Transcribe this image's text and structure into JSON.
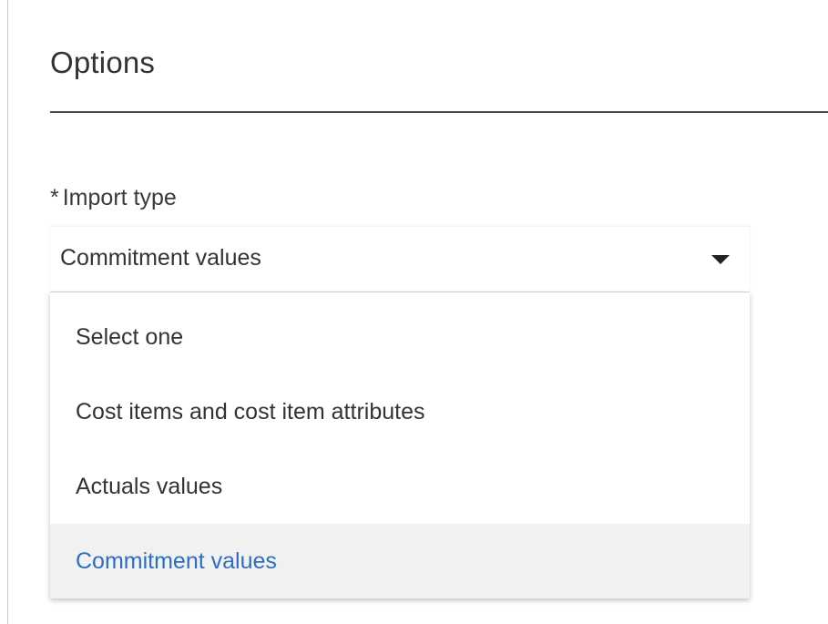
{
  "options": {
    "title": "Options"
  },
  "import_type": {
    "required_marker": "*",
    "label": "Import type",
    "selected_value": "Commitment values",
    "options": [
      {
        "label": "Select one",
        "selected": false
      },
      {
        "label": "Cost items and cost item attributes",
        "selected": false
      },
      {
        "label": "Actuals values",
        "selected": false
      },
      {
        "label": "Commitment values",
        "selected": true
      }
    ]
  },
  "colors": {
    "selected_text": "#2c6fc2",
    "selected_background": "#f1f1f2",
    "divider": "#4a4a4a"
  },
  "icons": {
    "dropdown_caret": "caret-down-icon"
  }
}
